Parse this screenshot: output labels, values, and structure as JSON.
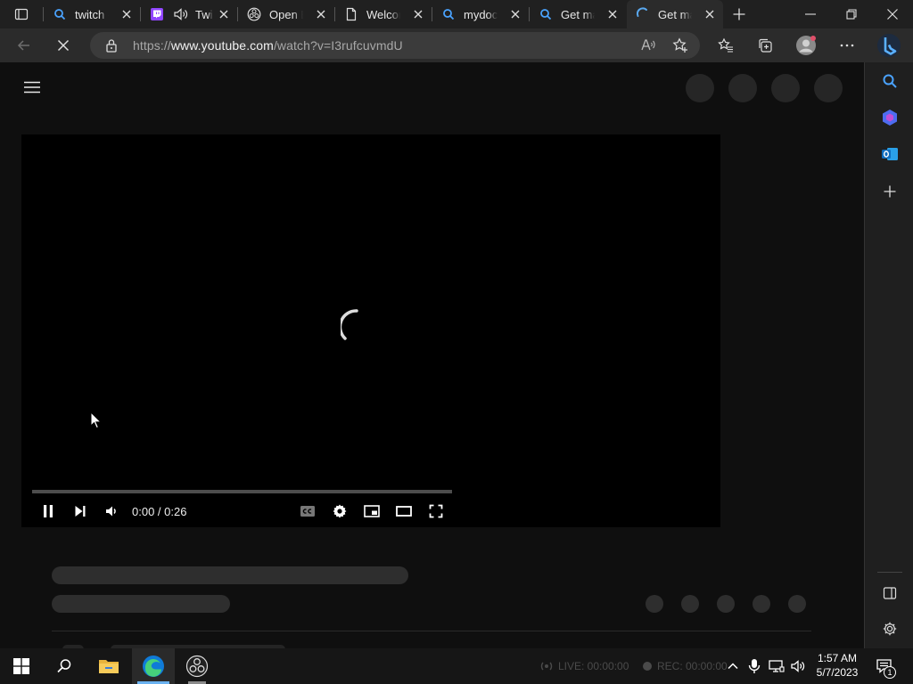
{
  "browser": {
    "tabs": [
      {
        "title": "twitch -",
        "favicon": "search-icon"
      },
      {
        "title": "Twi",
        "favicon": "twitch-icon"
      },
      {
        "title": "Open Br",
        "favicon": "obs-icon"
      },
      {
        "title": "Welcom",
        "favicon": "document-icon"
      },
      {
        "title": "mydock",
        "favicon": "search-icon"
      },
      {
        "title": "Get mac",
        "favicon": "search-icon"
      },
      {
        "title": "Get mac",
        "favicon": "loading-spinner-icon",
        "active": true
      }
    ],
    "address": {
      "scheme": "https://",
      "host": "www.youtube.com",
      "path": "/watch?v=I3rufcuvmdU"
    }
  },
  "player": {
    "time_current": "0:00",
    "time_separator": " / ",
    "time_total": "0:26",
    "state": "loading"
  },
  "taskbar": {
    "obs_live": "LIVE: 00:00:00",
    "obs_rec": "REC: 00:00:00",
    "clock_time": "1:57 AM",
    "clock_date": "5/7/2023",
    "notification_count": "1"
  },
  "colors": {
    "accent": "#3ea6ff",
    "page_bg": "#0f0f0f",
    "skeleton": "#2e2e2e"
  }
}
